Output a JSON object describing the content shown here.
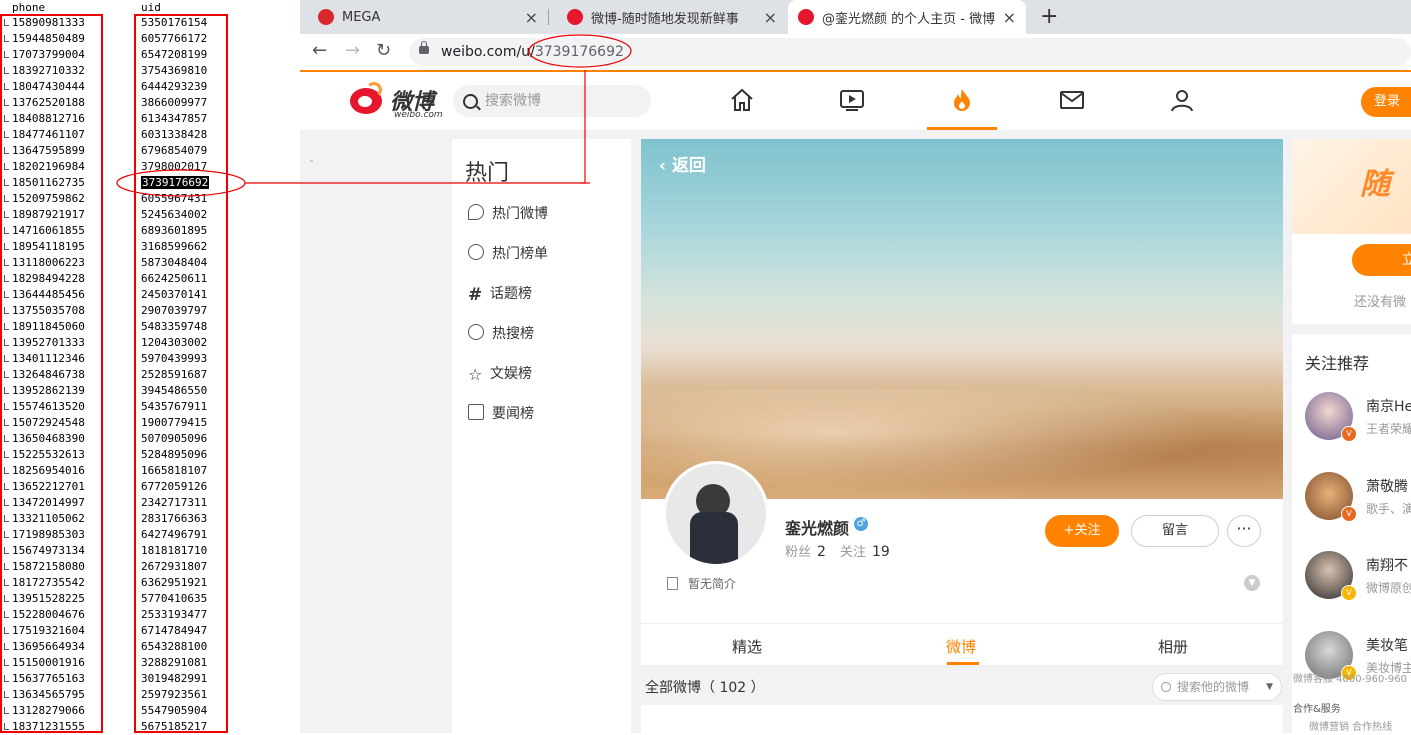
{
  "sheet": {
    "header_phone": "phone",
    "header_uid": "uid",
    "rows": [
      [
        "15890981333",
        "5350176154"
      ],
      [
        "15944850489",
        "6057766172"
      ],
      [
        "17073799004",
        "6547208199"
      ],
      [
        "18392710332",
        "3754369810"
      ],
      [
        "18047430444",
        "6444293239"
      ],
      [
        "13762520188",
        "3866009977"
      ],
      [
        "18408812716",
        "6134347857"
      ],
      [
        "18477461107",
        "6031338428"
      ],
      [
        "13647595899",
        "6796854079"
      ],
      [
        "18202196984",
        "3798002017"
      ],
      [
        "18501162735",
        "3739176692"
      ],
      [
        "15209759862",
        "6055967431"
      ],
      [
        "18987921917",
        "5245634002"
      ],
      [
        "14716061855",
        "6893601895"
      ],
      [
        "18954118195",
        "3168599662"
      ],
      [
        "13118006223",
        "5873048404"
      ],
      [
        "18298494228",
        "6624250611"
      ],
      [
        "13644485456",
        "2450370141"
      ],
      [
        "13755035708",
        "2907039797"
      ],
      [
        "18911845060",
        "5483359748"
      ],
      [
        "13952701333",
        "1204303002"
      ],
      [
        "13401112346",
        "5970439993"
      ],
      [
        "13264846738",
        "2528591687"
      ],
      [
        "13952862139",
        "3945486550"
      ],
      [
        "15574613520",
        "5435767911"
      ],
      [
        "15072924548",
        "1900779415"
      ],
      [
        "13650468390",
        "5070905096"
      ],
      [
        "15225532613",
        "5284895096"
      ],
      [
        "18256954016",
        "1665818107"
      ],
      [
        "13652212701",
        "6772059126"
      ],
      [
        "13472014997",
        "2342717311"
      ],
      [
        "13321105062",
        "2831766363"
      ],
      [
        "17198985303",
        "6427496791"
      ],
      [
        "15674973134",
        "1818181710"
      ],
      [
        "15872158080",
        "2672931807"
      ],
      [
        "18172735542",
        "6362951921"
      ],
      [
        "13951528225",
        "5770410635"
      ],
      [
        "15228004676",
        "2533193477"
      ],
      [
        "17519321604",
        "6714784947"
      ],
      [
        "13695664934",
        "6543288100"
      ],
      [
        "15150001916",
        "3288291081"
      ],
      [
        "15637765163",
        "3019482991"
      ],
      [
        "13634565795",
        "2597923561"
      ],
      [
        "13128279066",
        "5547905904"
      ],
      [
        "18371231555",
        "5675185217"
      ]
    ]
  },
  "browser": {
    "tabs": [
      {
        "label": "MEGA"
      },
      {
        "label": "微博-随时随地发现新鲜事"
      },
      {
        "label": "@銮光燃颜 的个人主页 - 微博"
      }
    ],
    "new_tab": "+",
    "url_prefix": "weibo.com/u/",
    "url_uid": "3739176692",
    "nav_back": "←",
    "nav_forward": "→",
    "nav_reload": "↻"
  },
  "weibo": {
    "logo_text": "微博",
    "logo_sub": "weibo.com",
    "search_placeholder": "搜索微博",
    "login": "登录",
    "left_nav": {
      "title": "热门",
      "items": [
        "热门微博",
        "热门榜单",
        "话题榜",
        "热搜榜",
        "文娱榜",
        "要闻榜"
      ]
    },
    "profile": {
      "back": "返回",
      "name": "銮光燃颜",
      "gender_symbol": "♂",
      "fans_label": "粉丝",
      "fans": "2",
      "follow_label": "关注",
      "follow_count": "19",
      "follow_btn": "+关注",
      "message_btn": "留言",
      "more_btn": "···",
      "intro": "暂无简介",
      "tabs": [
        "精选",
        "微博",
        "相册"
      ],
      "all_weibo": "全部微博（ 102 ）",
      "search_his": "搜索他的微博"
    },
    "right": {
      "promo_text": "还没有微",
      "promo_art": "随",
      "promo_btn": "立",
      "recommend_title": "关注推荐",
      "recs": [
        {
          "name": "南京He",
          "desc": "王者荣耀"
        },
        {
          "name": "萧敬腾",
          "desc": "歌手、演"
        },
        {
          "name": "南翔不",
          "desc": "微博原创"
        },
        {
          "name": "美妆笔",
          "desc": "美妆博主"
        }
      ],
      "footer_hotline": "微博客服 4000-960-960",
      "footer_coop": "合作&服务",
      "footer_links": "微博营销   合作热线"
    }
  }
}
